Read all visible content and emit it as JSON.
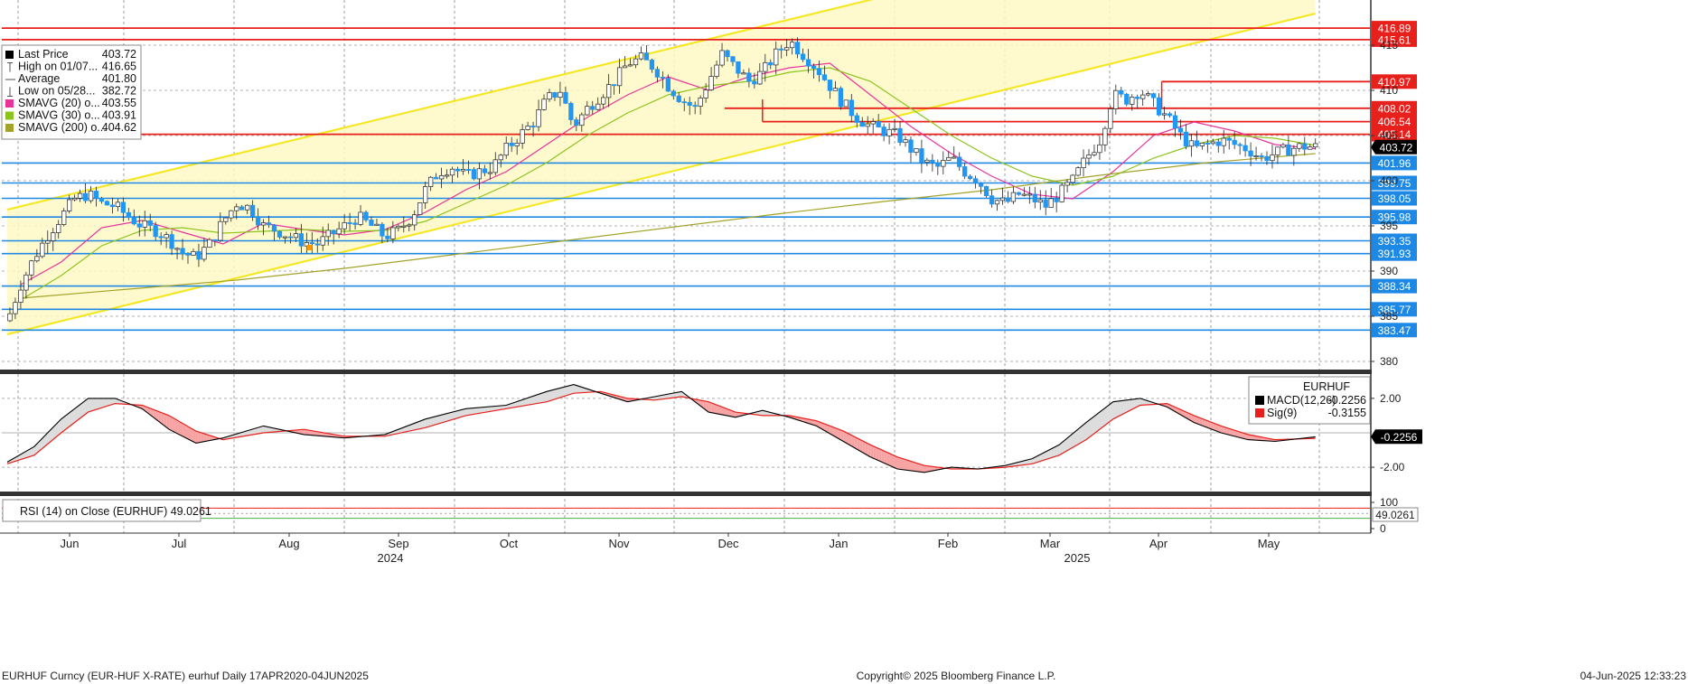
{
  "chart_data": {
    "type": "candlestick",
    "instrument": "EURHUF",
    "price_panel": {
      "ylim": [
        379,
        420
      ],
      "y_ticks": [
        380,
        385,
        390,
        395,
        400,
        405,
        410,
        415
      ],
      "x_months": [
        "Jun",
        "Jul",
        "Aug",
        "Sep",
        "Oct",
        "Nov",
        "Dec",
        "Jan",
        "Feb",
        "Mar",
        "Apr",
        "May"
      ],
      "x_years": [
        {
          "label": "2024",
          "after": "Aug"
        },
        {
          "label": "2025",
          "after": "Feb"
        }
      ],
      "close_series": [
        [
          0,
          384.5
        ],
        [
          5,
          388.5
        ],
        [
          10,
          391.5
        ],
        [
          15,
          394.0
        ],
        [
          20,
          396.0
        ],
        [
          25,
          398.0
        ],
        [
          30,
          398.5
        ],
        [
          35,
          397.5
        ],
        [
          40,
          397.2
        ],
        [
          45,
          396.0
        ],
        [
          50,
          395.0
        ],
        [
          55,
          394.5
        ],
        [
          60,
          393.5
        ],
        [
          65,
          392.0
        ],
        [
          70,
          391.5
        ],
        [
          75,
          393.0
        ],
        [
          80,
          395.5
        ],
        [
          85,
          397.5
        ],
        [
          90,
          397.0
        ],
        [
          95,
          395.0
        ],
        [
          100,
          394.5
        ],
        [
          105,
          393.8
        ],
        [
          110,
          393.2
        ],
        [
          115,
          393.0
        ],
        [
          120,
          394.0
        ],
        [
          125,
          395.0
        ],
        [
          130,
          396.0
        ],
        [
          135,
          395.0
        ],
        [
          140,
          393.8
        ],
        [
          145,
          394.5
        ],
        [
          150,
          396.0
        ],
        [
          155,
          399.0
        ],
        [
          160,
          401.0
        ],
        [
          165,
          401.5
        ],
        [
          170,
          400.5
        ],
        [
          175,
          401.0
        ],
        [
          180,
          401.5
        ],
        [
          185,
          403.5
        ],
        [
          190,
          405.0
        ],
        [
          195,
          406.5
        ],
        [
          200,
          409.0
        ],
        [
          205,
          410.0
        ],
        [
          210,
          406.0
        ],
        [
          215,
          408.0
        ],
        [
          220,
          409.5
        ],
        [
          225,
          411.0
        ],
        [
          230,
          413.0
        ],
        [
          235,
          413.5
        ],
        [
          240,
          412.5
        ],
        [
          245,
          410.5
        ],
        [
          250,
          409.0
        ],
        [
          255,
          408.0
        ],
        [
          260,
          411.0
        ],
        [
          265,
          414.0
        ],
        [
          270,
          412.5
        ],
        [
          275,
          411.0
        ],
        [
          280,
          412.0
        ],
        [
          285,
          414.0
        ],
        [
          290,
          415.5
        ],
        [
          295,
          414.0
        ],
        [
          300,
          412.5
        ],
        [
          305,
          410.5
        ],
        [
          310,
          408.5
        ],
        [
          315,
          407.0
        ],
        [
          320,
          406.0
        ],
        [
          325,
          405.5
        ],
        [
          330,
          405.0
        ],
        [
          335,
          403.5
        ],
        [
          340,
          402.0
        ],
        [
          345,
          401.5
        ],
        [
          350,
          402.5
        ],
        [
          355,
          401.0
        ],
        [
          360,
          400.0
        ],
        [
          365,
          398.0
        ],
        [
          370,
          397.5
        ],
        [
          375,
          398.5
        ],
        [
          380,
          398.0
        ],
        [
          385,
          397.2
        ],
        [
          390,
          398.5
        ],
        [
          395,
          400.0
        ],
        [
          400,
          402.5
        ],
        [
          405,
          404.5
        ],
        [
          410,
          409.5
        ],
        [
          415,
          409.0
        ],
        [
          420,
          410.0
        ],
        [
          425,
          408.5
        ],
        [
          430,
          407.0
        ],
        [
          435,
          405.0
        ],
        [
          440,
          403.5
        ],
        [
          445,
          404.0
        ],
        [
          450,
          404.5
        ],
        [
          455,
          404.0
        ],
        [
          460,
          403.5
        ],
        [
          465,
          402.5
        ],
        [
          470,
          403.0
        ],
        [
          475,
          403.5
        ],
        [
          480,
          403.8
        ],
        [
          485,
          403.72
        ]
      ],
      "series": [
        {
          "name": "Last Price",
          "color": "#000000"
        },
        {
          "name": "SMAVG (20)",
          "color": "#e8339c",
          "values": [
            [
              5,
              388.5
            ],
            [
              20,
              391.0
            ],
            [
              35,
              394.8
            ],
            [
              50,
              395.6
            ],
            [
              65,
              394.3
            ],
            [
              80,
              393.0
            ],
            [
              95,
              395.3
            ],
            [
              110,
              394.6
            ],
            [
              125,
              394.0
            ],
            [
              140,
              394.6
            ],
            [
              155,
              396.5
            ],
            [
              170,
              399.0
            ],
            [
              185,
              401.0
            ],
            [
              200,
              404.0
            ],
            [
              215,
              407.0
            ],
            [
              230,
              409.5
            ],
            [
              245,
              411.5
            ],
            [
              260,
              410.0
            ],
            [
              275,
              411.5
            ],
            [
              290,
              412.5
            ],
            [
              305,
              413.0
            ],
            [
              320,
              409.5
            ],
            [
              335,
              406.0
            ],
            [
              350,
              403.0
            ],
            [
              365,
              400.5
            ],
            [
              380,
              398.5
            ],
            [
              395,
              398.0
            ],
            [
              410,
              401.0
            ],
            [
              425,
              405.0
            ],
            [
              440,
              406.5
            ],
            [
              455,
              405.5
            ],
            [
              470,
              404.0
            ],
            [
              485,
              403.55
            ]
          ]
        },
        {
          "name": "SMAVG (30)",
          "color": "#8bc41c",
          "values": [
            [
              5,
              386.8
            ],
            [
              20,
              389.5
            ],
            [
              35,
              392.8
            ],
            [
              50,
              394.5
            ],
            [
              65,
              394.8
            ],
            [
              80,
              394.2
            ],
            [
              95,
              394.4
            ],
            [
              110,
              394.6
            ],
            [
              125,
              394.4
            ],
            [
              140,
              394.5
            ],
            [
              155,
              395.5
            ],
            [
              170,
              397.5
            ],
            [
              185,
              399.5
            ],
            [
              200,
              402.0
            ],
            [
              215,
              405.0
            ],
            [
              230,
              407.5
            ],
            [
              245,
              409.5
            ],
            [
              260,
              410.5
            ],
            [
              275,
              411.0
            ],
            [
              290,
              412.0
            ],
            [
              305,
              412.5
            ],
            [
              320,
              411.0
            ],
            [
              335,
              408.0
            ],
            [
              350,
              405.0
            ],
            [
              365,
              402.5
            ],
            [
              380,
              400.5
            ],
            [
              395,
              399.5
            ],
            [
              410,
              400.5
            ],
            [
              425,
              402.5
            ],
            [
              440,
              404.0
            ],
            [
              455,
              405.0
            ],
            [
              470,
              404.7
            ],
            [
              485,
              403.91
            ]
          ]
        },
        {
          "name": "SMAVG (200)",
          "color": "#a3a32a",
          "values": [
            [
              5,
              387.0
            ],
            [
              45,
              388.0
            ],
            [
              85,
              389.0
            ],
            [
              125,
              390.3
            ],
            [
              165,
              391.8
            ],
            [
              205,
              393.3
            ],
            [
              245,
              394.8
            ],
            [
              285,
              396.3
            ],
            [
              325,
              397.7
            ],
            [
              365,
              399.0
            ],
            [
              405,
              400.6
            ],
            [
              445,
              402.0
            ],
            [
              485,
              403.0
            ]
          ]
        }
      ],
      "legend": [
        {
          "label": "Last Price",
          "value": "403.72",
          "marker": "#000000"
        },
        {
          "label": "High on 01/07...",
          "value": "416.65",
          "marker": "high"
        },
        {
          "label": "Average",
          "value": "401.80",
          "marker": "avg"
        },
        {
          "label": "Low on 05/28...",
          "value": "382.72",
          "marker": "low"
        },
        {
          "label": "SMAVG (20)   o...",
          "value": "403.55",
          "marker": "#e8339c"
        },
        {
          "label": "SMAVG (30)   o...",
          "value": "403.91",
          "marker": "#8bc41c"
        },
        {
          "label": "SMAVG (200)   o...",
          "value": "404.62",
          "marker": "#a3a32a"
        }
      ],
      "red_levels": [
        {
          "value": 416.89,
          "label": "416.89"
        },
        {
          "value": 415.61,
          "label": "415.61"
        },
        {
          "value": 410.97,
          "label": "410.97"
        },
        {
          "value": 408.02,
          "label": "408.02"
        },
        {
          "value": 406.54,
          "label": "406.54"
        },
        {
          "value": 405.14,
          "label": "405.14"
        }
      ],
      "blue_levels": [
        {
          "value": 401.96,
          "label": "401.96"
        },
        {
          "value": 399.75,
          "label": "399.75"
        },
        {
          "value": 398.05,
          "label": "398.05"
        },
        {
          "value": 395.98,
          "label": "395.98"
        },
        {
          "value": 393.35,
          "label": "393.35"
        },
        {
          "value": 391.93,
          "label": "391.93"
        },
        {
          "value": 388.34,
          "label": "388.34"
        },
        {
          "value": 385.77,
          "label": "385.77"
        },
        {
          "value": 383.47,
          "label": "383.47"
        }
      ],
      "last_price_tag": "403.72",
      "channel": {
        "lower": [
          [
            0,
            383.0
          ],
          [
            485,
            418.5
          ]
        ],
        "upper": [
          [
            0,
            396.8
          ],
          [
            485,
            432.0
          ]
        ]
      }
    },
    "macd_panel": {
      "ylim": [
        -3.2,
        3.2
      ],
      "y_ticks": [
        {
          "value": 2.0,
          "label": "2.00"
        },
        {
          "value": -2.0,
          "label": "-2.00"
        }
      ],
      "legend_title": "EURHUF",
      "legend": [
        {
          "label": "MACD(12,26)",
          "value": "-0.2256",
          "color": "#000000"
        },
        {
          "label": "Sig(9)",
          "value": "-0.3155",
          "color": "#e8201c"
        }
      ],
      "last_tag": "-0.2256",
      "macd": [
        [
          0,
          -1.7
        ],
        [
          10,
          -0.8
        ],
        [
          20,
          0.8
        ],
        [
          30,
          2.0
        ],
        [
          40,
          2.0
        ],
        [
          50,
          1.4
        ],
        [
          60,
          0.2
        ],
        [
          70,
          -0.6
        ],
        [
          80,
          -0.3
        ],
        [
          95,
          0.4
        ],
        [
          110,
          -0.1
        ],
        [
          125,
          -0.3
        ],
        [
          140,
          -0.1
        ],
        [
          155,
          0.8
        ],
        [
          170,
          1.4
        ],
        [
          185,
          1.6
        ],
        [
          200,
          2.4
        ],
        [
          210,
          2.8
        ],
        [
          220,
          2.3
        ],
        [
          230,
          1.8
        ],
        [
          240,
          2.1
        ],
        [
          250,
          2.4
        ],
        [
          260,
          1.2
        ],
        [
          270,
          0.9
        ],
        [
          280,
          1.3
        ],
        [
          290,
          0.9
        ],
        [
          300,
          0.4
        ],
        [
          310,
          -0.5
        ],
        [
          320,
          -1.4
        ],
        [
          330,
          -2.1
        ],
        [
          340,
          -2.3
        ],
        [
          350,
          -2.0
        ],
        [
          360,
          -2.1
        ],
        [
          370,
          -1.9
        ],
        [
          380,
          -1.5
        ],
        [
          390,
          -0.7
        ],
        [
          400,
          0.6
        ],
        [
          410,
          1.8
        ],
        [
          420,
          2.0
        ],
        [
          430,
          1.5
        ],
        [
          440,
          0.6
        ],
        [
          450,
          0.0
        ],
        [
          460,
          -0.4
        ],
        [
          470,
          -0.5
        ],
        [
          485,
          -0.23
        ]
      ],
      "signal": [
        [
          0,
          -1.8
        ],
        [
          10,
          -1.3
        ],
        [
          20,
          0.0
        ],
        [
          30,
          1.2
        ],
        [
          40,
          1.7
        ],
        [
          50,
          1.6
        ],
        [
          60,
          1.0
        ],
        [
          70,
          0.1
        ],
        [
          80,
          -0.4
        ],
        [
          95,
          0.0
        ],
        [
          110,
          0.2
        ],
        [
          125,
          -0.2
        ],
        [
          140,
          -0.2
        ],
        [
          155,
          0.3
        ],
        [
          170,
          1.0
        ],
        [
          185,
          1.4
        ],
        [
          200,
          1.8
        ],
        [
          210,
          2.3
        ],
        [
          220,
          2.4
        ],
        [
          230,
          2.0
        ],
        [
          240,
          1.9
        ],
        [
          250,
          2.1
        ],
        [
          260,
          1.8
        ],
        [
          270,
          1.2
        ],
        [
          280,
          1.0
        ],
        [
          290,
          1.0
        ],
        [
          300,
          0.7
        ],
        [
          310,
          0.1
        ],
        [
          320,
          -0.7
        ],
        [
          330,
          -1.4
        ],
        [
          340,
          -1.9
        ],
        [
          350,
          -2.1
        ],
        [
          360,
          -2.1
        ],
        [
          370,
          -2.0
        ],
        [
          380,
          -1.8
        ],
        [
          390,
          -1.3
        ],
        [
          400,
          -0.4
        ],
        [
          410,
          0.8
        ],
        [
          420,
          1.6
        ],
        [
          430,
          1.7
        ],
        [
          440,
          1.0
        ],
        [
          450,
          0.4
        ],
        [
          460,
          -0.1
        ],
        [
          470,
          -0.4
        ],
        [
          485,
          -0.32
        ]
      ]
    },
    "rsi_panel": {
      "title": "RSI (14)  on Close (EURHUF) 49.0261",
      "y_ticks": [
        {
          "value": 100,
          "label": "100"
        },
        {
          "value": 0,
          "label": "0"
        }
      ],
      "last_tag": "49.0261"
    },
    "footer": {
      "left": "EURHUF Curncy (EUR-HUF X-RATE) eurhuf  Daily 17APR2020-04JUN2025",
      "center": "Copyright© 2025 Bloomberg Finance L.P.",
      "right": "04-Jun-2025 12:33:23"
    },
    "colors": {
      "up": "#ffffff",
      "down": "#2196f3",
      "channel_fill": "#fff9c4",
      "channel_line": "#f6e61c",
      "red_level": "#e8201c",
      "blue_level": "#1e88e5"
    }
  }
}
